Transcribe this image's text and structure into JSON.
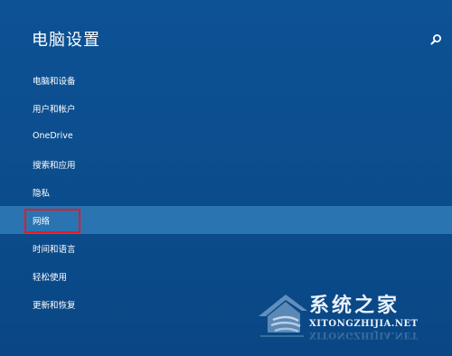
{
  "header": {
    "title": "电脑设置",
    "search_icon": "search-icon"
  },
  "nav": {
    "items": [
      {
        "label": "电脑和设备"
      },
      {
        "label": "用户和帐户"
      },
      {
        "label": "OneDrive"
      },
      {
        "label": "搜索和应用"
      },
      {
        "label": "隐私"
      },
      {
        "label": "网络",
        "selected": true
      },
      {
        "label": "时间和语言"
      },
      {
        "label": "轻松使用"
      },
      {
        "label": "更新和恢复"
      }
    ]
  },
  "watermark": {
    "title": "系统之家",
    "url": "XITONGZHIJIA.NET"
  },
  "colors": {
    "background": "#0c4f8f",
    "selected_item": "#2a74b2",
    "highlight_box": "#e41b23",
    "text": "#ffffff"
  }
}
